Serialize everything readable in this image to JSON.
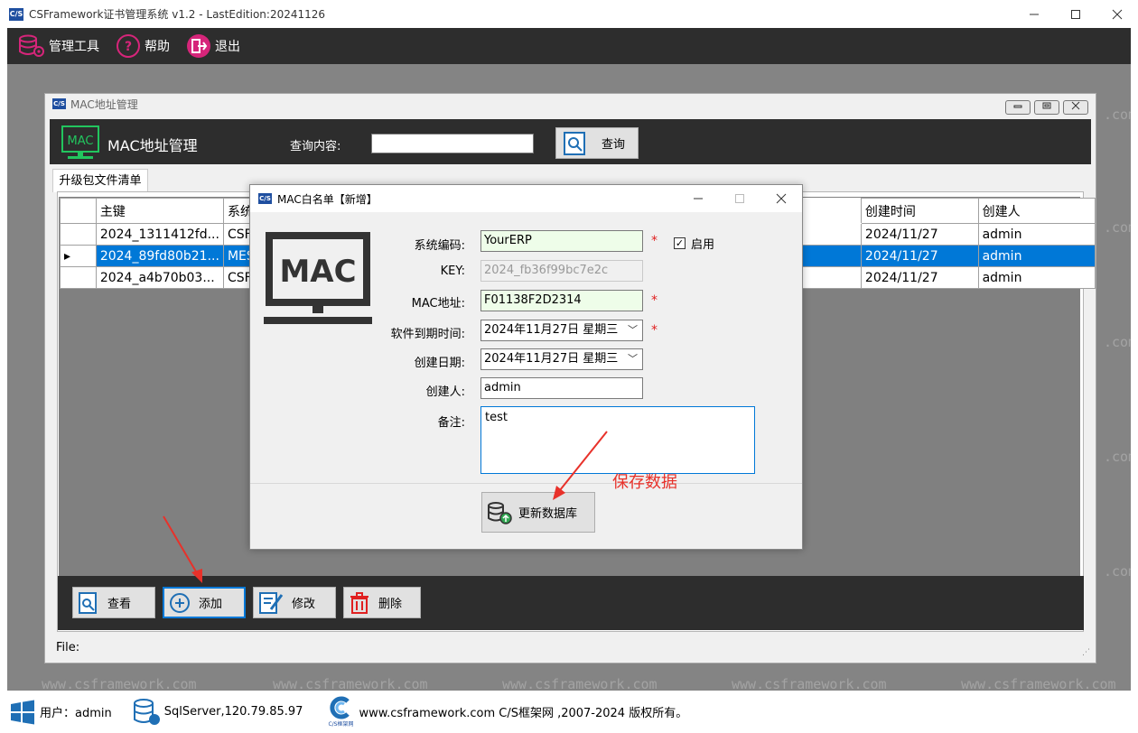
{
  "app": {
    "logo_text": "C/S",
    "title": "CSFramework证书管理系统 v1.2 - LastEdition:20241126"
  },
  "menubar": {
    "items": [
      {
        "label": "管理工具",
        "icon": "database-gear-icon"
      },
      {
        "label": "帮助",
        "icon": "help-circle-icon"
      },
      {
        "label": "退出",
        "icon": "exit-icon"
      }
    ]
  },
  "watermark": {
    "url": "www.csframework.com",
    "short": ".com"
  },
  "child": {
    "title": "MAC地址管理",
    "header_title": "MAC地址管理",
    "query_label": "查询内容:",
    "query_value": "",
    "query_button": "查询",
    "tab_label": "升级包文件清单",
    "columns": [
      "主键",
      "系统编",
      "创建时间",
      "创建人"
    ],
    "rows": [
      {
        "key": "2024_1311412fd...",
        "code": "CSFra",
        "date": "2024/11/27",
        "user": "admin",
        "selected": false
      },
      {
        "key": "2024_89fd80b21...",
        "code": "MES",
        "date": "2024/11/27",
        "user": "admin",
        "selected": true
      },
      {
        "key": "2024_a4b70b03...",
        "code": "CSFra",
        "date": "2024/11/27",
        "user": "admin",
        "selected": false
      }
    ],
    "row_indicator": "▸",
    "buttons": {
      "view": "查看",
      "add": "添加",
      "edit": "修改",
      "delete": "删除"
    },
    "status_label": "File:"
  },
  "dialog": {
    "title": "MAC白名单【新增】",
    "mac_art_text": "MAC",
    "fields": {
      "system_code_label": "系统编码:",
      "system_code_value": "YourERP",
      "enabled_label": "启用",
      "enabled": true,
      "key_label": "KEY:",
      "key_value": "2024_fb36f99bc7e2c",
      "mac_label": "MAC地址:",
      "mac_value": "F01138F2D2314",
      "expire_label": "软件到期时间:",
      "expire_value": "2024年11月27日 星期三",
      "created_label": "创建日期:",
      "created_value": "2024年11月27日 星期三",
      "creator_label": "创建人:",
      "creator_value": "admin",
      "remark_label": "备注:",
      "remark_value": "test"
    },
    "required_mark": "*",
    "save_button": "更新数据库"
  },
  "annotation": "保存数据",
  "taskbar": {
    "user": "用户：admin",
    "server": "SqlServer,120.79.85.97",
    "logo_caption": "C/S框架网",
    "copyright": "www.csframework.com C/S框架网 ,2007-2024 版权所有。"
  },
  "colors": {
    "dark_bar": "#2d2d2d",
    "workspace": "#848484",
    "selection": "#0078d7",
    "required_bg": "#eefde9",
    "annotation": "#e8312a",
    "header_icon": "#22c55e",
    "menu_icon": "#d6257a"
  }
}
